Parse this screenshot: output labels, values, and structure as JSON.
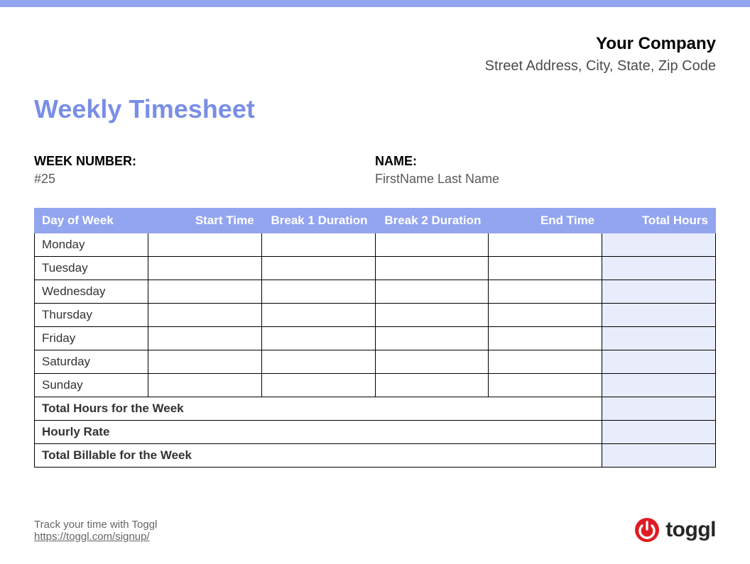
{
  "company": {
    "name": "Your Company",
    "address": "Street Address, City, State, Zip Code"
  },
  "title": "Weekly Timesheet",
  "meta": {
    "week_label": "WEEK NUMBER:",
    "week_value": "#25",
    "name_label": "NAME:",
    "name_value": "FirstName Last Name"
  },
  "table": {
    "headers": {
      "day": "Day of Week",
      "start": "Start Time",
      "break1": "Break 1 Duration",
      "break2": "Break 2 Duration",
      "end": "End Time",
      "total": "Total Hours"
    },
    "rows": [
      {
        "day": "Monday",
        "start": "",
        "break1": "",
        "break2": "",
        "end": "",
        "total": ""
      },
      {
        "day": "Tuesday",
        "start": "",
        "break1": "",
        "break2": "",
        "end": "",
        "total": ""
      },
      {
        "day": "Wednesday",
        "start": "",
        "break1": "",
        "break2": "",
        "end": "",
        "total": ""
      },
      {
        "day": "Thursday",
        "start": "",
        "break1": "",
        "break2": "",
        "end": "",
        "total": ""
      },
      {
        "day": "Friday",
        "start": "",
        "break1": "",
        "break2": "",
        "end": "",
        "total": ""
      },
      {
        "day": "Saturday",
        "start": "",
        "break1": "",
        "break2": "",
        "end": "",
        "total": ""
      },
      {
        "day": "Sunday",
        "start": "",
        "break1": "",
        "break2": "",
        "end": "",
        "total": ""
      }
    ],
    "summary": {
      "total_hours_label": "Total Hours for the Week",
      "total_hours_value": "",
      "hourly_rate_label": "Hourly Rate",
      "hourly_rate_value": "",
      "total_billable_label": "Total Billable for the Week",
      "total_billable_value": ""
    }
  },
  "footer": {
    "tagline": "Track your time with Toggl",
    "url": "https://toggl.com/signup/",
    "brand": "toggl"
  }
}
